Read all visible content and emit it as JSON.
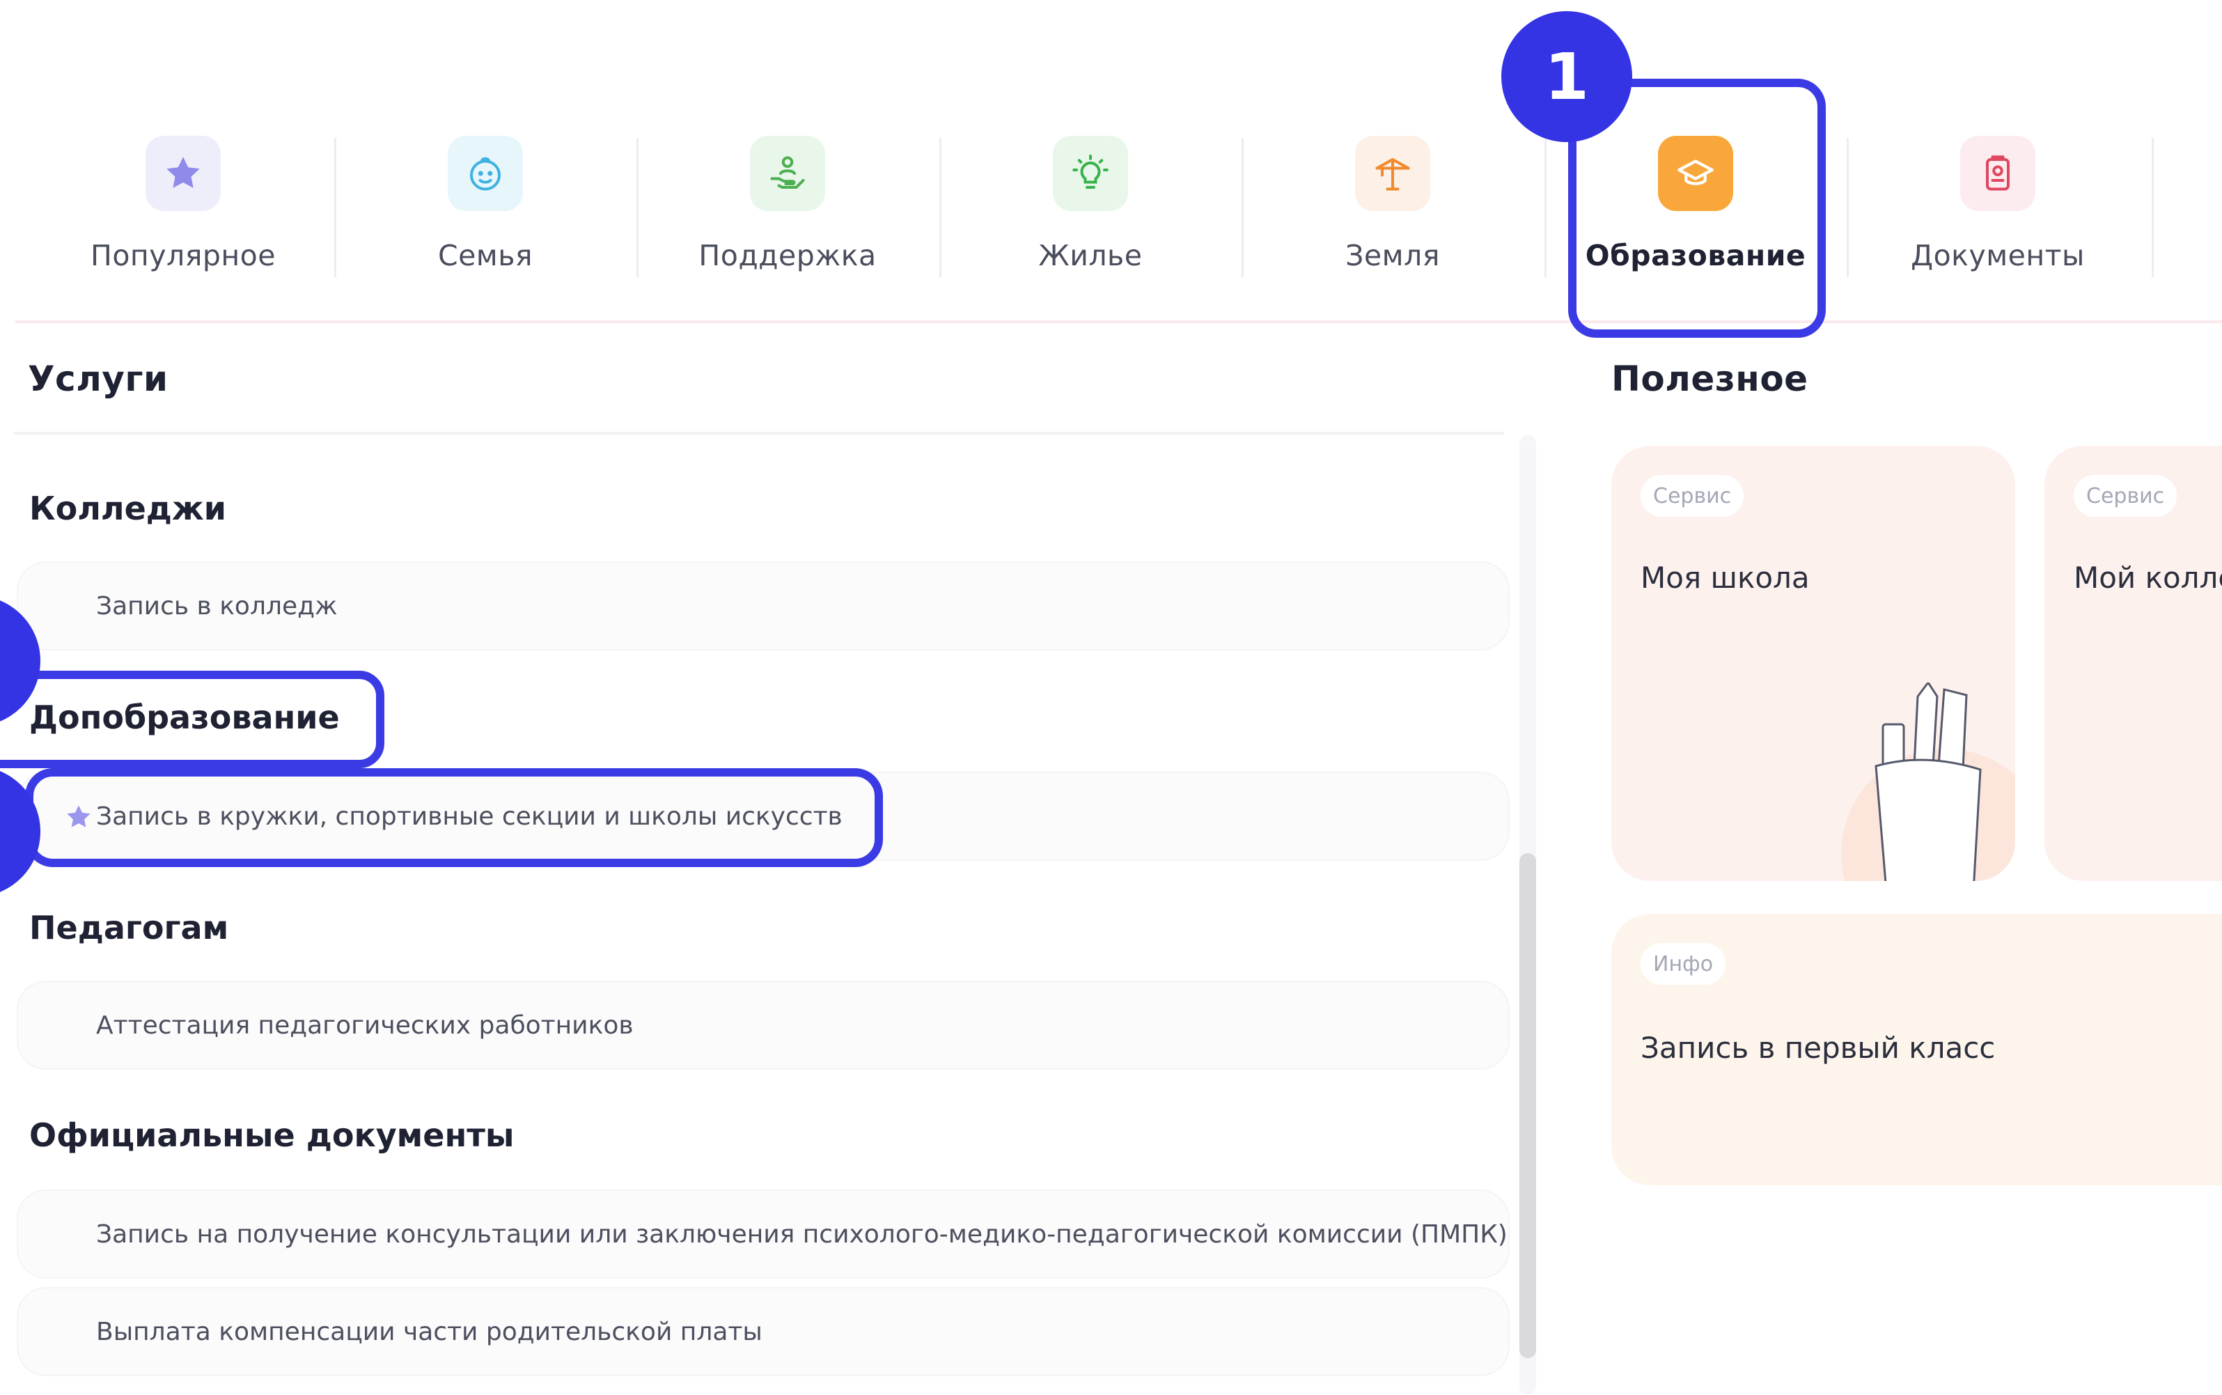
{
  "categories": [
    {
      "label": "Популярное",
      "icon": "star-icon",
      "bg": "#eeeefb",
      "color": "#8f8bea"
    },
    {
      "label": "Семья",
      "icon": "baby-face-icon",
      "bg": "#e7f6fb",
      "color": "#3fb1e0"
    },
    {
      "label": "Поддержка",
      "icon": "hand-person-icon",
      "bg": "#e9f6ea",
      "color": "#4caf50"
    },
    {
      "label": "Жилье",
      "icon": "lightbulb-icon",
      "bg": "#e9f7ea",
      "color": "#36b34a"
    },
    {
      "label": "Земля",
      "icon": "crane-icon",
      "bg": "#fdf0e6",
      "color": "#f08a2c"
    },
    {
      "label": "Образование",
      "icon": "graduation-cap-icon",
      "bg": "#f9a73a",
      "color": "#ffffff",
      "active": true
    },
    {
      "label": "Документы",
      "icon": "passport-icon",
      "bg": "#fdecef",
      "color": "#e0475f"
    }
  ],
  "markers": {
    "step1": "1"
  },
  "services": {
    "title": "Услуги",
    "groups": [
      {
        "title": "Колледжи",
        "items": [
          "Запись в колледж"
        ]
      },
      {
        "title": "Допобразование",
        "items": [
          "Запись в кружки, спортивные секции и школы искусств"
        ]
      },
      {
        "title": "Педагогам",
        "items": [
          "Аттестация педагогических работников"
        ]
      },
      {
        "title": "Официальные документы",
        "items": [
          "Запись на получение консультации или заключения психолого-медико-педагогической комиссии (ПМПК)",
          "Выплата компенсации части родительской платы"
        ]
      }
    ]
  },
  "useful": {
    "title": "Полезное",
    "cards": [
      {
        "badge": "Сервис",
        "title": "Моя школа"
      },
      {
        "badge": "Сервис",
        "title": "Мой колле"
      },
      {
        "badge": "Инфо",
        "title": "Запись в первый класс"
      }
    ]
  },
  "colors": {
    "highlight": "#3b3be6",
    "marker": "#3434e4",
    "star": "#9b96ee"
  }
}
